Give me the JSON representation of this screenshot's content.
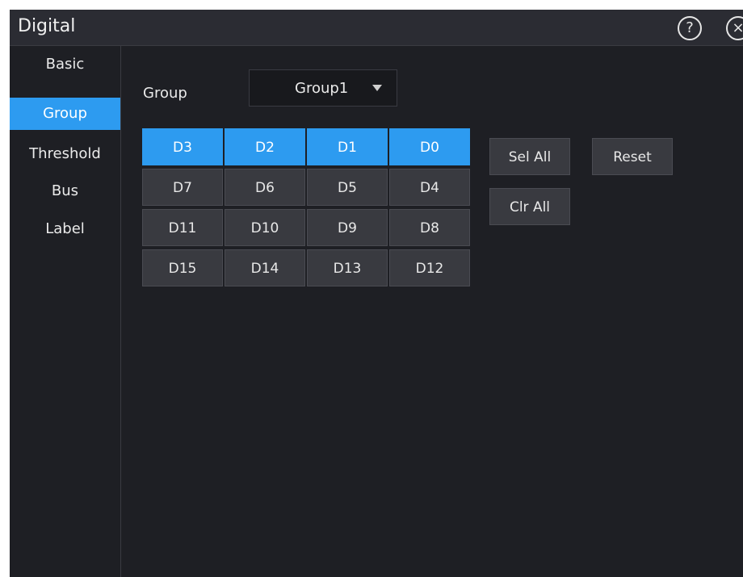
{
  "window": {
    "title": "Digital"
  },
  "titlebar": {
    "help_glyph": "?",
    "close_glyph": "×"
  },
  "sidebar": {
    "items": [
      {
        "label": "Basic",
        "active": false
      },
      {
        "label": "Group",
        "active": true
      },
      {
        "label": "Threshold",
        "active": false
      },
      {
        "label": "Bus",
        "active": false
      },
      {
        "label": "Label",
        "active": false
      }
    ]
  },
  "group": {
    "label": "Group",
    "selected": "Group1"
  },
  "channels": {
    "rows": [
      [
        {
          "label": "D3",
          "selected": true
        },
        {
          "label": "D2",
          "selected": true
        },
        {
          "label": "D1",
          "selected": true
        },
        {
          "label": "D0",
          "selected": true
        }
      ],
      [
        {
          "label": "D7",
          "selected": false
        },
        {
          "label": "D6",
          "selected": false
        },
        {
          "label": "D5",
          "selected": false
        },
        {
          "label": "D4",
          "selected": false
        }
      ],
      [
        {
          "label": "D11",
          "selected": false
        },
        {
          "label": "D10",
          "selected": false
        },
        {
          "label": "D9",
          "selected": false
        },
        {
          "label": "D8",
          "selected": false
        }
      ],
      [
        {
          "label": "D15",
          "selected": false
        },
        {
          "label": "D14",
          "selected": false
        },
        {
          "label": "D13",
          "selected": false
        },
        {
          "label": "D12",
          "selected": false
        }
      ]
    ]
  },
  "actions": {
    "sel_all": "Sel All",
    "reset": "Reset",
    "clr_all": "Clr All"
  },
  "colors": {
    "accent": "#2d9bf0",
    "background": "#1e1f24",
    "button": "#393a40"
  }
}
